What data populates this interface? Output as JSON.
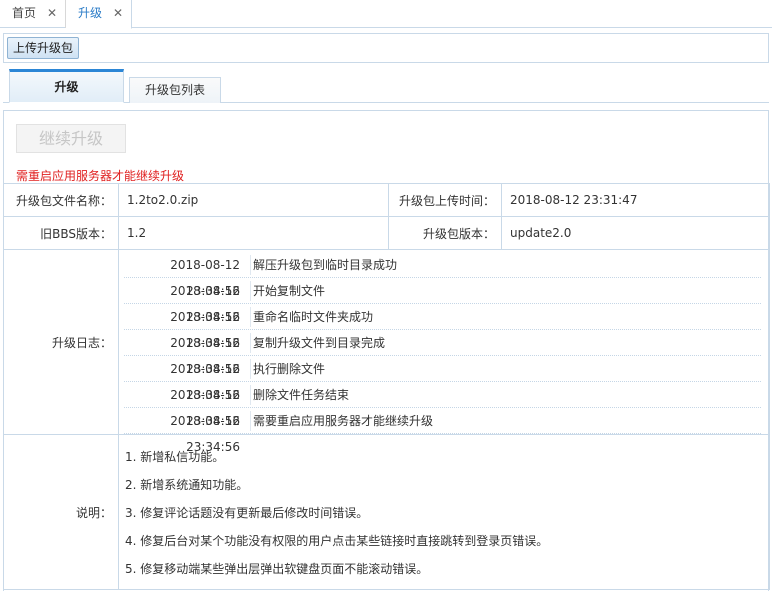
{
  "top_tabs": [
    {
      "label": "首页",
      "close": "✕"
    },
    {
      "label": "升级",
      "close": "✕"
    }
  ],
  "toolbar": {
    "upload_label": "上传升级包"
  },
  "inner_tabs": [
    {
      "label": "升级"
    },
    {
      "label": "升级包列表"
    }
  ],
  "continue_button": "继续升级",
  "notice": "需重启应用服务器才能继续升级",
  "info": {
    "file_name_label": "升级包文件名称：",
    "file_name_value": "1.2to2.0.zip",
    "upload_time_label": "升级包上传时间：",
    "upload_time_value": "2018-08-12 23:31:47",
    "old_version_label": "旧BBS版本：",
    "old_version_value": "1.2",
    "pkg_version_label": "升级包版本：",
    "pkg_version_value": "update2.0",
    "log_label": "升级日志：",
    "desc_label": "说明："
  },
  "logs": [
    {
      "time": "2018-08-12 23:34:56",
      "msg": "解压升级包到临时目录成功"
    },
    {
      "time": "2018-08-12 23:34:56",
      "msg": "开始复制文件"
    },
    {
      "time": "2018-08-12 23:34:56",
      "msg": "重命名临时文件夹成功"
    },
    {
      "time": "2018-08-12 23:34:56",
      "msg": "复制升级文件到目录完成"
    },
    {
      "time": "2018-08-12 23:34:56",
      "msg": "执行删除文件"
    },
    {
      "time": "2018-08-12 23:34:56",
      "msg": "删除文件任务结束"
    },
    {
      "time": "2018-08-12 23:34:56",
      "msg": "需要重启应用服务器才能继续升级"
    }
  ],
  "descriptions": [
    "1. 新增私信功能。",
    "2. 新增系统通知功能。",
    "3. 修复评论话题没有更新最后修改时间错误。",
    "4. 修复后台对某个功能没有权限的用户点击某些链接时直接跳转到登录页错误。",
    "5. 修复移动端某些弹出层弹出软键盘页面不能滚动错误。"
  ],
  "colors": {
    "accent": "#2b86d6",
    "notice": "#e02020",
    "border": "#c9d9e8"
  }
}
